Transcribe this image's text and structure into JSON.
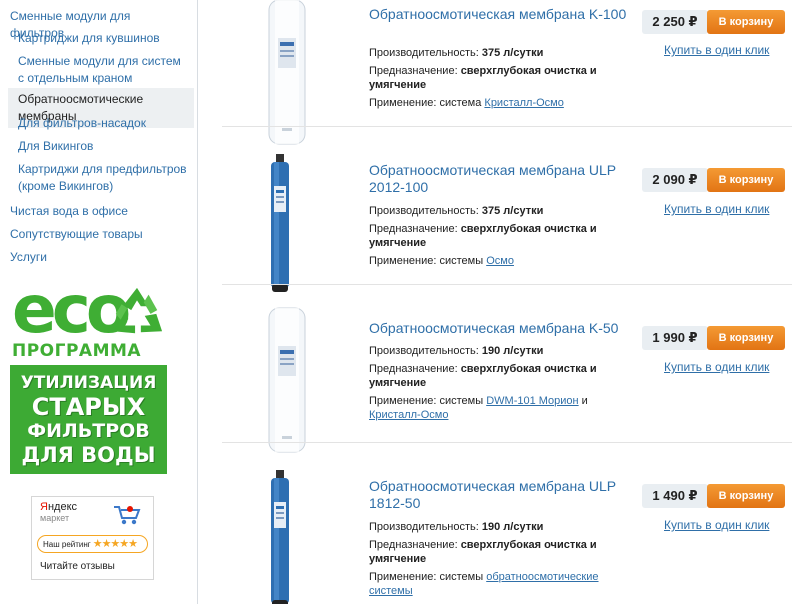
{
  "sidebar": {
    "items": [
      {
        "label": "Сменные модули для фильтров"
      },
      {
        "label": "Картриджи для кувшинов"
      },
      {
        "label": "Сменные модули для систем с отдельным краном"
      },
      {
        "label": "Обратноосмотические мембраны",
        "active": true
      },
      {
        "label": "Для фильтров-насадок"
      },
      {
        "label": "Для Викингов"
      },
      {
        "label": "Картриджи для предфильтров (кроме Викингов)"
      },
      {
        "label": "Чистая вода в офисе"
      },
      {
        "label": "Сопутствующие товары"
      },
      {
        "label": "Услуги"
      }
    ]
  },
  "eco_banner": {
    "line1": "УТИЛИЗАЦИЯ",
    "line2": "СТАРЫХ",
    "line3": "ФИЛЬТРОВ",
    "line4": "ДЛЯ ВОДЫ",
    "logo_text": "eco",
    "subtitle": "ПРОГРАММА",
    "color_green": "#3daa34"
  },
  "yandex_widget": {
    "brand_first": "Я",
    "brand_rest": "ндекс",
    "market": "маркет",
    "rating_label": "Наш рейтинг",
    "stars": "★★★★★",
    "reviews": "Читайте отзывы"
  },
  "labels": {
    "productivity": "Производительность:",
    "purpose": "Предназначение:",
    "application": "Применение:",
    "add_to_cart": "В корзину",
    "one_click": "Купить в один клик"
  },
  "products": [
    {
      "title": "Обратноосмотическая мембрана K-100",
      "price": "2 250 ₽",
      "productivity": "375 л/сутки",
      "purpose": "сверхглубокая очистка и умягчение",
      "application_prefix": "система",
      "links": [
        "Кристалл-Осмо"
      ],
      "image": "white-cartridge"
    },
    {
      "title": "Обратноосмотическая мембрана ULP 2012-100",
      "price": "2 090 ₽",
      "productivity": "375 л/сутки",
      "purpose": "сверхглубокая очистка и умягчение",
      "application_prefix": "системы",
      "links": [
        "Осмо"
      ],
      "image": "blue-membrane"
    },
    {
      "title": "Обратноосмотическая мембрана K-50",
      "price": "1 990 ₽",
      "productivity": "190 л/сутки",
      "purpose": "сверхглубокая очистка и умягчение",
      "application_prefix": "системы",
      "links": [
        "DWM-101 Морион",
        "Кристалл-Осмо"
      ],
      "link_joiner": "и",
      "image": "white-cartridge"
    },
    {
      "title": "Обратноосмотическая мембрана ULP 1812-50",
      "price": "1 490 ₽",
      "productivity": "190 л/сутки",
      "purpose": "сверхглубокая очистка и умягчение",
      "application_prefix": "системы",
      "links": [
        "обратноосмотические системы"
      ],
      "image": "blue-membrane"
    }
  ],
  "colors": {
    "link": "#2f6fa8",
    "cart_button": "#f08a24",
    "price_bg": "#e9eef2"
  }
}
